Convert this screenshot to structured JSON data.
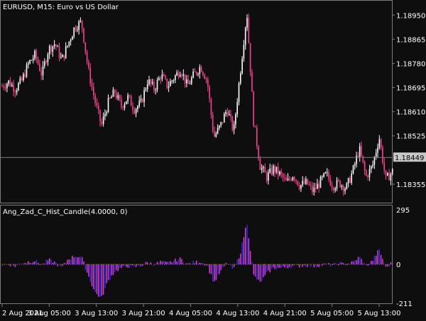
{
  "colors": {
    "background": "#0e0e0e",
    "frame": "#7d7d7d",
    "text": "#ffffff",
    "candle_up": "#ffffff",
    "candle_down": "#ff3f8f",
    "hist_blue": "#3b2cff",
    "hist_magenta": "#e040e0",
    "bid_line": "#7c7c7c",
    "bid_label_bg": "#c8c8c8",
    "bid_label_text": "#000000",
    "zero_line": "#9aa000"
  },
  "main_chart": {
    "symbol_label": "EURUSD, M15:  Euro vs US Dollar",
    "bid_label": "1.18449",
    "bid_value": 1.18449,
    "price_min": 1.1829,
    "price_max": 1.19003,
    "price_ticks": [
      {
        "value": 1.1895,
        "label": "1.18950"
      },
      {
        "value": 1.18865,
        "label": "1.18865"
      },
      {
        "value": 1.1878,
        "label": "1.18780"
      },
      {
        "value": 1.18695,
        "label": "1.18695"
      },
      {
        "value": 1.1861,
        "label": "1.18610"
      },
      {
        "value": 1.18525,
        "label": "1.18525"
      },
      {
        "value": 1.18355,
        "label": "1.18355"
      }
    ]
  },
  "indicator": {
    "label": "Ang_Zad_C_Hist_Candle(4.0000, 0)",
    "min": -211,
    "max": 295,
    "ticks": [
      {
        "value": 295,
        "label": "295"
      },
      {
        "value": 0,
        "label": "0"
      },
      {
        "value": -211,
        "label": "-211"
      }
    ]
  },
  "time_axis": {
    "labels": [
      "2 Aug 2021",
      "3 Aug 05:00",
      "3 Aug 13:00",
      "3 Aug 21:00",
      "4 Aug 05:00",
      "4 Aug 13:00",
      "4 Aug 21:00",
      "5 Aug 05:00",
      "5 Aug 13:00"
    ]
  },
  "chart_data": {
    "type": "candlestick",
    "title": "EURUSD, M15:  Euro vs US Dollar",
    "close_price_path": [
      1.187,
      1.18715,
      1.1869,
      1.1872,
      1.1878,
      1.1881,
      1.1874,
      1.1883,
      1.1885,
      1.1879,
      1.1885,
      1.1891,
      1.18925,
      1.1876,
      1.1865,
      1.1856,
      1.1864,
      1.1868,
      1.1863,
      1.1866,
      1.1862,
      1.1864,
      1.1872,
      1.1869,
      1.1874,
      1.187,
      1.1873,
      1.1876,
      1.187,
      1.1874,
      1.1877,
      1.1872,
      1.1852,
      1.1856,
      1.1862,
      1.1854,
      1.1875,
      1.1896,
      1.1858,
      1.1842,
      1.1838,
      1.1841,
      1.1839,
      1.1836,
      1.1839,
      1.1835,
      1.1836,
      1.1833,
      1.1836,
      1.1839,
      1.1835,
      1.1836,
      1.1834,
      1.184,
      1.1848,
      1.1838,
      1.1842,
      1.1852,
      1.1837,
      1.184
    ],
    "histogram_path": [
      -5,
      0,
      -10,
      5,
      15,
      20,
      -5,
      25,
      10,
      -20,
      30,
      45,
      40,
      -60,
      -150,
      -185,
      -90,
      -40,
      -20,
      -10,
      -15,
      -5,
      10,
      0,
      15,
      5,
      20,
      30,
      0,
      10,
      15,
      -5,
      -100,
      -40,
      10,
      -30,
      60,
      230,
      -60,
      -100,
      -50,
      -20,
      -20,
      -15,
      -10,
      -10,
      -5,
      -10,
      -5,
      0,
      -5,
      5,
      0,
      10,
      40,
      -10,
      20,
      80,
      -20,
      10
    ]
  }
}
